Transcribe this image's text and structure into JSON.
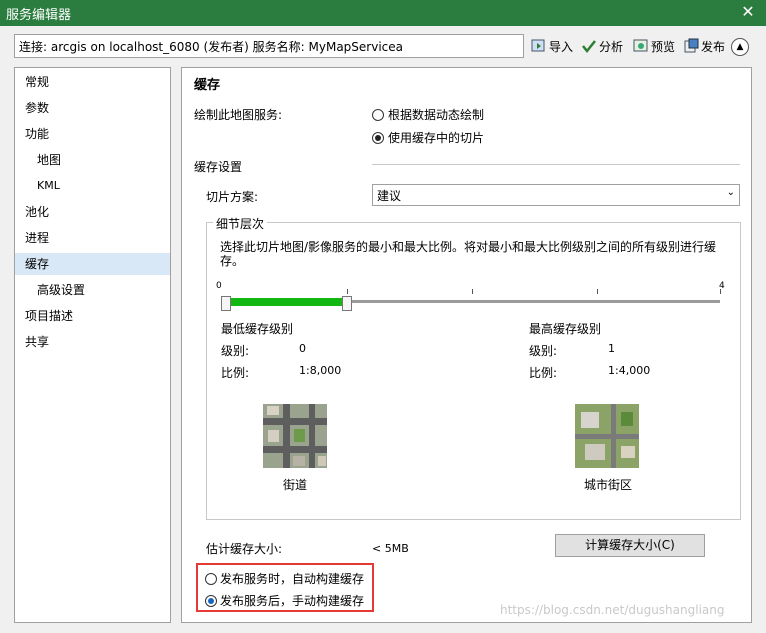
{
  "window": {
    "title": "服务编辑器",
    "close_glyph": "✕"
  },
  "toolbar": {
    "connection_text": "连接: arcgis on localhost_6080 (发布者)    服务名称: MyMapServicea",
    "import_label": "导入",
    "analyze_label": "分析",
    "preview_label": "预览",
    "publish_label": "发布"
  },
  "nav": {
    "items": [
      {
        "label": "常规"
      },
      {
        "label": "参数"
      },
      {
        "label": "功能"
      },
      {
        "label": "地图"
      },
      {
        "label": "KML"
      },
      {
        "label": "池化"
      },
      {
        "label": "进程"
      },
      {
        "label": "缓存"
      },
      {
        "label": "高级设置"
      },
      {
        "label": "项目描述"
      },
      {
        "label": "共享"
      }
    ],
    "selected": "缓存"
  },
  "cache": {
    "title": "缓存",
    "draw_label": "绘制此地图服务:",
    "draw_options": [
      "根据数据动态绘制",
      "使用缓存中的切片"
    ],
    "draw_selected_index": 1,
    "settings_label": "缓存设置",
    "tiling_scheme_label": "切片方案:",
    "tiling_scheme_value": "建议",
    "lod": {
      "legend": "细节层次",
      "description": "选择此切片地图/影像服务的最小和最大比例。将对最小和最大比例级别之间的所有级别进行缓存。",
      "slider_min_label": "0",
      "slider_max_label": "4",
      "min_level": 0,
      "max_level": 1,
      "min_title": "最低缓存级别",
      "max_title": "最高缓存级别",
      "level_label": "级别:",
      "scale_label": "比例:",
      "min_level_value": "0",
      "min_scale_value": "1:8,000",
      "max_level_value": "1",
      "max_scale_value": "1:4,000",
      "min_thumb_caption": "街道",
      "max_thumb_caption": "城市街区"
    },
    "estimate_label": "估计缓存大小:",
    "estimate_value": "< 5MB",
    "calc_button": "计算缓存大小(C)",
    "build_options": [
      "发布服务时，自动构建缓存",
      "发布服务后，手动构建缓存"
    ],
    "build_selected_index": 1
  },
  "watermark": "https://blog.csdn.net/dugushangliang"
}
